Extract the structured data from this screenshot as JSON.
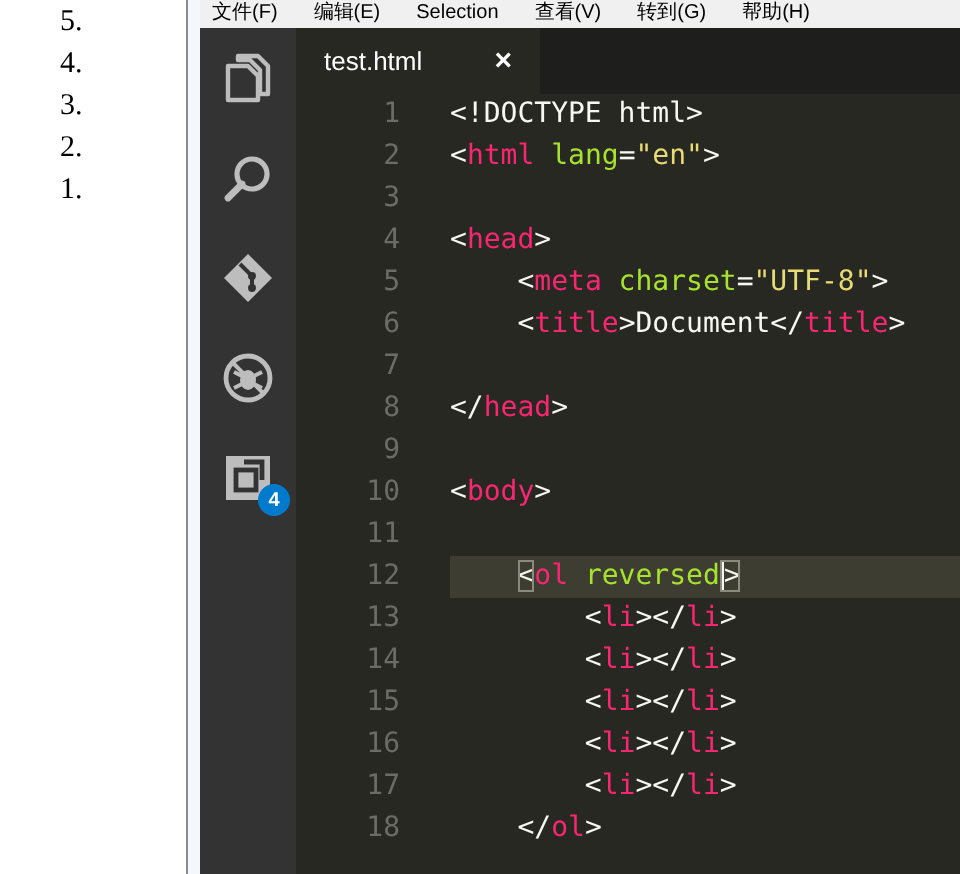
{
  "preview_list": [
    "5.",
    "4.",
    "3.",
    "2.",
    "1."
  ],
  "menu": [
    "文件(F)",
    "编辑(E)",
    "Selection",
    "查看(V)",
    "转到(G)",
    "帮助(H)"
  ],
  "activity_bar": {
    "badge": "4"
  },
  "tabs": [
    {
      "label": "test.html",
      "close": "×",
      "selected": true
    }
  ],
  "lines": [
    {
      "number": "1",
      "current": false,
      "tokens": [
        {
          "kind": "punct",
          "text": "<!DOCTYPE html>"
        }
      ]
    },
    {
      "number": "2",
      "current": false,
      "tokens": [
        {
          "kind": "punct",
          "text": "<"
        },
        {
          "kind": "tag",
          "text": "html"
        },
        {
          "kind": "attr",
          "text": " lang"
        },
        {
          "kind": "punct",
          "text": "="
        },
        {
          "kind": "string",
          "text": "\"en\""
        },
        {
          "kind": "punct",
          "text": ">"
        }
      ]
    },
    {
      "number": "3",
      "current": false
    },
    {
      "number": "4",
      "current": false,
      "tokens": [
        {
          "kind": "punct",
          "text": "<"
        },
        {
          "kind": "tag",
          "text": "head"
        },
        {
          "kind": "punct",
          "text": ">"
        }
      ]
    },
    {
      "number": "5",
      "current": false,
      "tokens": [
        {
          "kind": "punct",
          "text": "    <"
        },
        {
          "kind": "tag",
          "text": "meta"
        },
        {
          "kind": "attr",
          "text": " charset"
        },
        {
          "kind": "punct",
          "text": "="
        },
        {
          "kind": "string",
          "text": "\"UTF-8\""
        },
        {
          "kind": "punct",
          "text": ">"
        }
      ]
    },
    {
      "number": "6",
      "current": false,
      "tokens": [
        {
          "kind": "punct",
          "text": "    <"
        },
        {
          "kind": "tag",
          "text": "title"
        },
        {
          "kind": "punct",
          "text": ">Document</"
        },
        {
          "kind": "tag",
          "text": "title"
        },
        {
          "kind": "punct",
          "text": ">"
        }
      ]
    },
    {
      "number": "7",
      "current": false
    },
    {
      "number": "8",
      "current": false,
      "tokens": [
        {
          "kind": "punct",
          "text": "</"
        },
        {
          "kind": "tag",
          "text": "head"
        },
        {
          "kind": "punct",
          "text": ">"
        }
      ]
    },
    {
      "number": "9",
      "current": false
    },
    {
      "number": "10",
      "current": false,
      "tokens": [
        {
          "kind": "punct",
          "text": "<"
        },
        {
          "kind": "tag",
          "text": "body"
        },
        {
          "kind": "punct",
          "text": ">"
        }
      ]
    },
    {
      "number": "11",
      "current": false
    },
    {
      "number": "12",
      "current": true,
      "tokens": [
        {
          "kind": "punct",
          "text": "    <"
        },
        {
          "kind": "tag",
          "text": "ol"
        },
        {
          "kind": "attr",
          "text": " reversed"
        },
        {
          "kind": "punct",
          "text": ">"
        }
      ]
    },
    {
      "number": "13",
      "current": false,
      "tokens": [
        {
          "kind": "punct",
          "text": "        <"
        },
        {
          "kind": "tag",
          "text": "li"
        },
        {
          "kind": "punct",
          "text": "></"
        },
        {
          "kind": "tag",
          "text": "li"
        },
        {
          "kind": "punct",
          "text": ">"
        }
      ]
    },
    {
      "number": "14",
      "current": false,
      "tokens": [
        {
          "kind": "punct",
          "text": "        <"
        },
        {
          "kind": "tag",
          "text": "li"
        },
        {
          "kind": "punct",
          "text": "></"
        },
        {
          "kind": "tag",
          "text": "li"
        },
        {
          "kind": "punct",
          "text": ">"
        }
      ]
    },
    {
      "number": "15",
      "current": false,
      "tokens": [
        {
          "kind": "punct",
          "text": "        <"
        },
        {
          "kind": "tag",
          "text": "li"
        },
        {
          "kind": "punct",
          "text": "></"
        },
        {
          "kind": "tag",
          "text": "li"
        },
        {
          "kind": "punct",
          "text": ">"
        }
      ]
    },
    {
      "number": "16",
      "current": false,
      "tokens": [
        {
          "kind": "punct",
          "text": "        <"
        },
        {
          "kind": "tag",
          "text": "li"
        },
        {
          "kind": "punct",
          "text": "></"
        },
        {
          "kind": "tag",
          "text": "li"
        },
        {
          "kind": "punct",
          "text": ">"
        }
      ]
    },
    {
      "number": "17",
      "current": false,
      "tokens": [
        {
          "kind": "punct",
          "text": "        <"
        },
        {
          "kind": "tag",
          "text": "li"
        },
        {
          "kind": "punct",
          "text": "></"
        },
        {
          "kind": "tag",
          "text": "li"
        },
        {
          "kind": "punct",
          "text": ">"
        }
      ]
    },
    {
      "number": "18",
      "current": false,
      "tokens": [
        {
          "kind": "punct",
          "text": "    </"
        },
        {
          "kind": "tag",
          "text": "ol"
        },
        {
          "kind": "punct",
          "text": ">"
        }
      ]
    }
  ]
}
